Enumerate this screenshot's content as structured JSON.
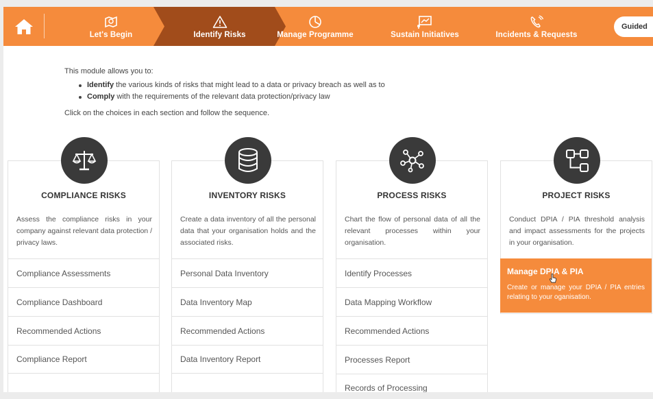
{
  "nav": {
    "steps": [
      {
        "label": "Let's Begin",
        "icon": "puzzle-map-icon"
      },
      {
        "label": "Identify Risks",
        "icon": "warning-triangle-icon",
        "active": true
      },
      {
        "label": "Manage Programme",
        "icon": "pie-chart-icon"
      },
      {
        "label": "Sustain Initiatives",
        "icon": "presentation-board-icon"
      },
      {
        "label": "Incidents & Requests",
        "icon": "phone-call-icon"
      }
    ],
    "guided_label": "Guided",
    "accent": "#f58b3c",
    "active_color": "#a14c1b"
  },
  "intro": {
    "lead": "This module allows you to:",
    "bullets": [
      {
        "em": "Identify",
        "rest": " the various kinds of risks that might lead to a data or privacy breach as well as to"
      },
      {
        "em": "Comply",
        "rest": " with the requirements of the relevant data protection/privacy law"
      }
    ],
    "follow": "Click on the choices in each section and follow the sequence."
  },
  "cards": [
    {
      "title": "COMPLIANCE RISKS",
      "icon": "scales-icon",
      "desc": "Assess the compliance risks in your company against relevant data protection / privacy laws.",
      "options": [
        "Compliance Assessments",
        "Compliance Dashboard",
        "Recommended Actions",
        "Compliance Report"
      ]
    },
    {
      "title": "INVENTORY RISKS",
      "icon": "database-icon",
      "desc": "Create a data inventory of all the personal data that your organisation holds and the associated risks.",
      "options": [
        "Personal Data Inventory",
        "Data Inventory Map",
        "Recommended Actions",
        "Data Inventory Report"
      ]
    },
    {
      "title": "PROCESS RISKS",
      "icon": "network-icon",
      "desc": "Chart the flow of personal data of all the relevant processes within your organisation.",
      "options": [
        "Identify Processes",
        "Data Mapping Workflow",
        "Recommended Actions",
        "Processes Report",
        "Records of Processing"
      ]
    },
    {
      "title": "PROJECT RISKS",
      "icon": "flowchart-icon",
      "desc": "Conduct DPIA / PIA threshold analysis and impact assessments for the projects in your organisation.",
      "highlight": {
        "title": "Manage DPIA & PIA",
        "desc": "Create or manage your DPIA / PIA entries relating to your oganisation."
      }
    }
  ]
}
